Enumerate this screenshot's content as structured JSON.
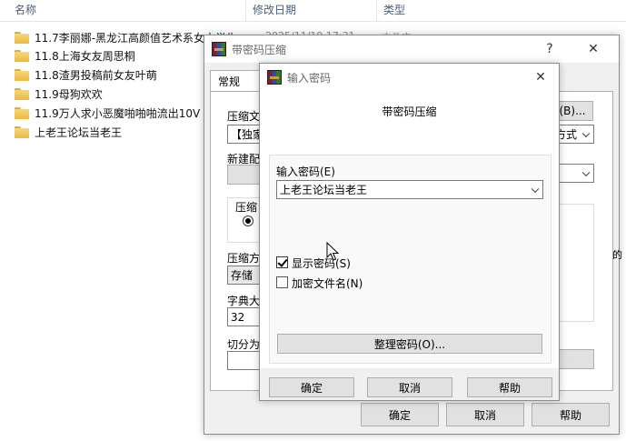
{
  "explorer": {
    "columns": {
      "name": "名称",
      "modified": "修改日期",
      "type": "类型"
    },
    "files": [
      {
        "name": "11.7李丽娜-黑龙江高颜值艺术系女大学生"
      },
      {
        "name": "11.8上海女友周思桐"
      },
      {
        "name": "11.8渣男投稿前女友叶萌"
      },
      {
        "name": "11.9母狗欢欢"
      },
      {
        "name": "11.9万人求小恶魔啪啪啪流出10V 5"
      },
      {
        "name": "上老王论坛当老王"
      }
    ],
    "partial_date": "2025/11/19 17:31",
    "partial_type": "文件夹"
  },
  "archive_dialog": {
    "title": "带密码压缩",
    "help": "?",
    "close": "✕",
    "tab_general": "常规",
    "archive_name_label": "压缩文",
    "archive_name_value": "【独家",
    "browse_button": "(B)...",
    "update_mode_partial": "方式",
    "profile_label": "新建配",
    "format_label": "压缩",
    "method_label": "压缩方",
    "method_value": "存储",
    "dict_label": "字典大",
    "dict_value": "32",
    "split_label": "切分为",
    "right_partial": "的",
    "ok": "确定",
    "cancel": "取消",
    "help_button": "帮助"
  },
  "password_dialog": {
    "title": "输入密码",
    "close": "✕",
    "heading": "带密码压缩",
    "password_label": "输入密码(E)",
    "password_value": "上老王论坛当老王",
    "show_password": {
      "label": "显示密码(S)",
      "checked": true
    },
    "encrypt_names": {
      "label": "加密文件名(N)",
      "checked": false
    },
    "organize_button": "整理密码(O)...",
    "ok": "确定",
    "cancel": "取消",
    "help_button": "帮助"
  }
}
